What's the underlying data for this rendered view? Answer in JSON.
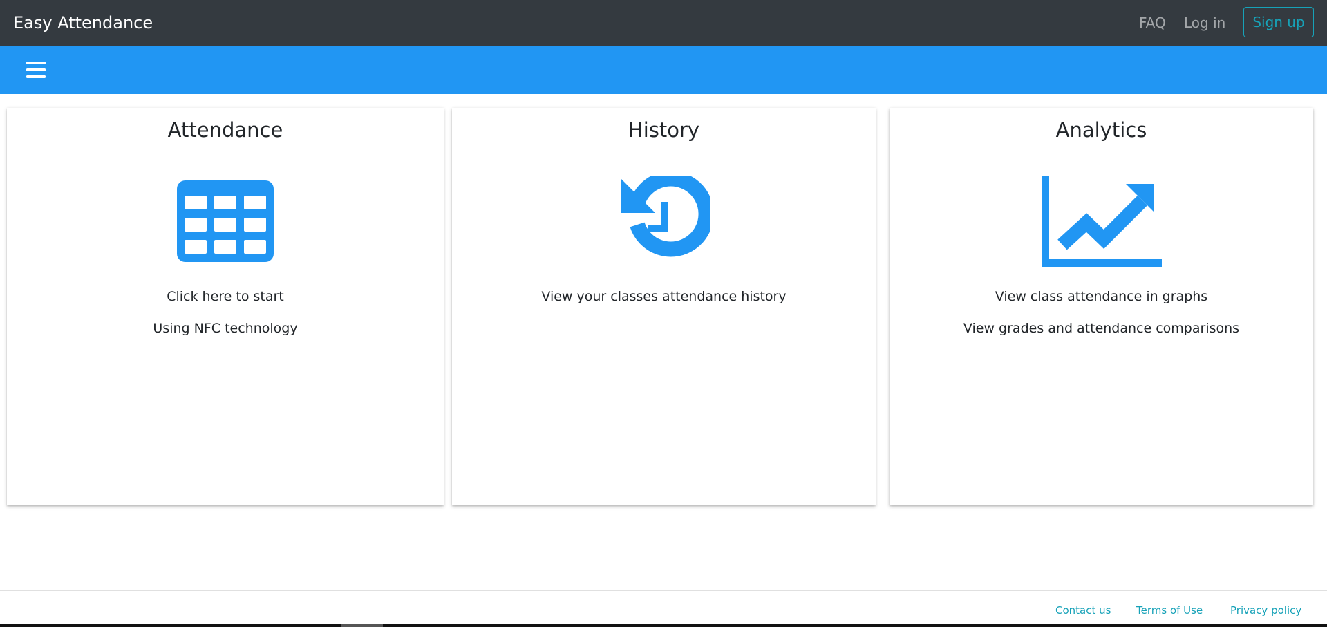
{
  "header": {
    "brand": "Easy Attendance",
    "faq_label": "FAQ",
    "login_label": "Log in",
    "signup_label": "Sign up"
  },
  "toolbar": {
    "menu_icon": "hamburger-menu-icon"
  },
  "cards": [
    {
      "title": "Attendance",
      "icon": "table-grid-icon",
      "lines": [
        "Click here to start",
        "Using NFC technology"
      ]
    },
    {
      "title": "History",
      "icon": "history-clock-icon",
      "lines": [
        "View your classes attendance history"
      ]
    },
    {
      "title": "Analytics",
      "icon": "line-chart-icon",
      "lines": [
        "View class attendance in graphs",
        "View grades and attendance comparisons"
      ]
    }
  ],
  "footer": {
    "contact": "Contact us",
    "terms": "Terms of Use",
    "privacy": "Privacy policy"
  },
  "colors": {
    "navbar": "#343a40",
    "accent_bar": "#2196f3",
    "icon": "#2196f3",
    "link": "#17a2b8"
  }
}
